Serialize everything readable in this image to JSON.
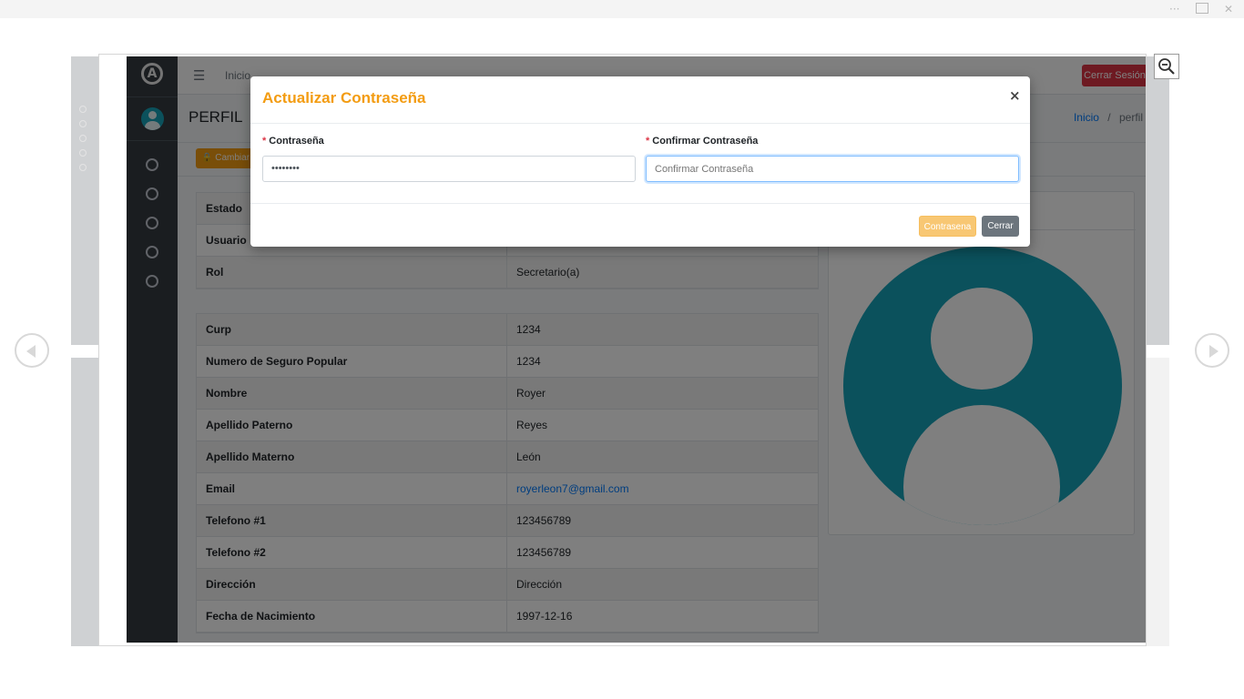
{
  "app": {
    "navbar": {
      "home_link": "Inicio",
      "logout_label": "Cerrar Sesión"
    },
    "header": {
      "title": "PERFIL",
      "breadcrumb_home": "Inicio",
      "breadcrumb_sep": "/",
      "breadcrumb_current": "perfil"
    },
    "toolbar": {
      "change_password_label": "Cambiar"
    },
    "account_table": [
      {
        "label": "Estado",
        "value": ""
      },
      {
        "label": "Usuario",
        "value": ""
      },
      {
        "label": "Rol",
        "value": "Secretario(a)"
      }
    ],
    "profile_table": [
      {
        "label": "Curp",
        "value": "1234"
      },
      {
        "label": "Numero de Seguro Popular",
        "value": "1234"
      },
      {
        "label": "Nombre",
        "value": "Royer"
      },
      {
        "label": "Apellido Paterno",
        "value": "Reyes"
      },
      {
        "label": "Apellido Materno",
        "value": "León"
      },
      {
        "label": "Email",
        "value": "royerleon7@gmail.com"
      },
      {
        "label": "Telefono #1",
        "value": "123456789"
      },
      {
        "label": "Telefono #2",
        "value": "123456789"
      },
      {
        "label": "Dirección",
        "value": "Dirección"
      },
      {
        "label": "Fecha de Nacimiento",
        "value": "1997-12-16"
      }
    ]
  },
  "modal": {
    "title": "Actualizar Contraseña",
    "close_symbol": "×",
    "password_required_mark": "*",
    "password_label": "Contraseña",
    "password_value": "••••••••",
    "confirm_required_mark": "*",
    "confirm_label": "Confirmar Contraseña",
    "confirm_placeholder": "Confirmar Contraseña",
    "save_label": "Contrasena",
    "close_label": "Cerrar"
  },
  "viewer": {
    "more_symbol": "···",
    "close_symbol": "✕"
  },
  "colors": {
    "accent": "#f39c12",
    "sidebar": "#343a40",
    "danger": "#dc3545",
    "avatar": "#17a2b8",
    "link": "#007bff"
  },
  "icons": [
    "menu-icon",
    "logo-icon",
    "user-avatar-icon",
    "circle-icon",
    "lock-icon",
    "zoom-out-icon",
    "chevron-left-icon",
    "chevron-right-icon",
    "close-icon"
  ]
}
